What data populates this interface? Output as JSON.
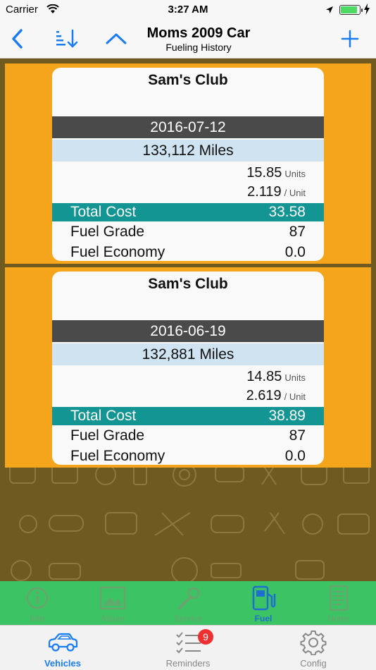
{
  "status_bar": {
    "carrier": "Carrier",
    "time": "3:27 AM"
  },
  "nav": {
    "title": "Moms 2009 Car",
    "subtitle": "Fueling History",
    "accent": "#1a7cf2"
  },
  "records": [
    {
      "station": "Sam's Club",
      "date": "2016-07-12",
      "miles": "133,112 Miles",
      "units_value": "15.85",
      "units_label": "Units",
      "price_value": "2.119",
      "price_label": "/ Unit",
      "total_cost_label": "Total Cost",
      "total_cost": "33.58",
      "fuel_grade_label": "Fuel Grade",
      "fuel_grade": "87",
      "fuel_economy_label": "Fuel Economy",
      "fuel_economy": "0.0"
    },
    {
      "station": "Sam's Club",
      "date": "2016-06-19",
      "miles": "132,881 Miles",
      "units_value": "14.85",
      "units_label": "Units",
      "price_value": "2.619",
      "price_label": "/ Unit",
      "total_cost_label": "Total Cost",
      "total_cost": "38.89",
      "fuel_grade_label": "Fuel Grade",
      "fuel_grade": "87",
      "fuel_economy_label": "Fuel Economy",
      "fuel_economy": "0.0"
    }
  ],
  "segments": [
    {
      "label": "Info",
      "icon": "info-icon"
    },
    {
      "label": "Album",
      "icon": "album-icon"
    },
    {
      "label": "Service",
      "icon": "wrench-icon"
    },
    {
      "label": "Fuel",
      "icon": "fuel-pump-icon",
      "active": true
    },
    {
      "label": "Notes",
      "icon": "notes-icon"
    }
  ],
  "tabs": [
    {
      "label": "Vehicles",
      "icon": "car-icon",
      "active": true
    },
    {
      "label": "Reminders",
      "icon": "checklist-icon",
      "badge": "9"
    },
    {
      "label": "Config",
      "icon": "gear-icon"
    }
  ],
  "colors": {
    "background": "#6f5a22",
    "record_frame": "#f4a51c",
    "date_row": "#4a4a4a",
    "miles_row": "#cfe3f1",
    "total_row": "#129593",
    "segment_bar": "#3cc464",
    "badge": "#f03030"
  }
}
